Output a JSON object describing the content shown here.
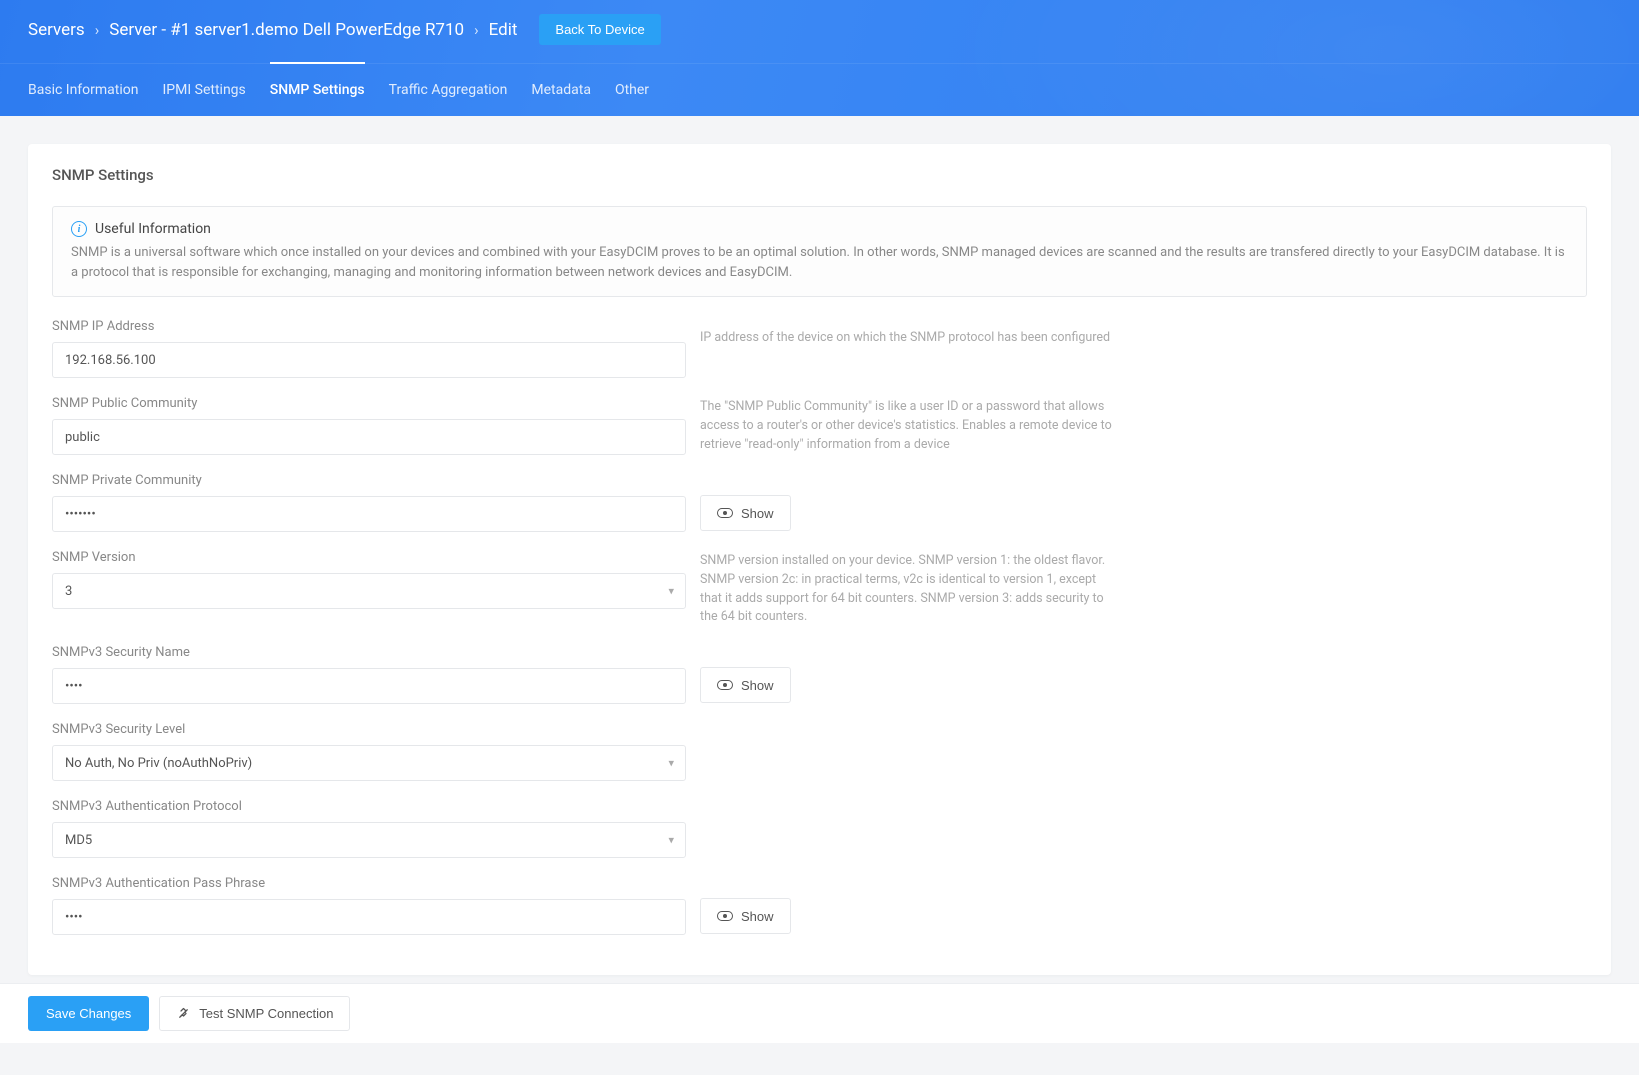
{
  "breadcrumb": {
    "root": "Servers",
    "server": "Server - #1 server1.demo Dell PowerEdge R710",
    "current": "Edit",
    "back_btn": "Back To Device"
  },
  "tabs": {
    "basic": "Basic Information",
    "ipmi": "IPMI Settings",
    "snmp": "SNMP Settings",
    "traffic": "Traffic Aggregation",
    "metadata": "Metadata",
    "other": "Other"
  },
  "section": {
    "title": "SNMP Settings"
  },
  "info": {
    "title": "Useful Information",
    "text": "SNMP is a universal software which once installed on your devices and combined with your EasyDCIM proves to be an optimal solution. In other words, SNMP managed devices are scanned and the results are transfered directly to your EasyDCIM database. It is a protocol that is responsible for exchanging, managing and monitoring information between network devices and EasyDCIM."
  },
  "fields": {
    "ip": {
      "label": "SNMP IP Address",
      "value": "192.168.56.100",
      "help": "IP address of the device on which the SNMP protocol has been configured"
    },
    "public_comm": {
      "label": "SNMP Public Community",
      "value": "public",
      "help": "The \"SNMP Public Community\" is like a user ID or a password that allows access to a router's or other device's statistics. Enables a remote device to retrieve \"read-only\" information from a device"
    },
    "private_comm": {
      "label": "SNMP Private Community",
      "value": "private",
      "show_label": "Show"
    },
    "version": {
      "label": "SNMP Version",
      "value": "3",
      "help": "SNMP version installed on your device. SNMP version 1: the oldest flavor. SNMP version 2c: in practical terms, v2c is identical to version 1, except that it adds support for 64 bit counters. SNMP version 3: adds security to the 64 bit counters."
    },
    "sec_name": {
      "label": "SNMPv3 Security Name",
      "value": "none",
      "show_label": "Show"
    },
    "sec_level": {
      "label": "SNMPv3 Security Level",
      "value": "No Auth, No Priv (noAuthNoPriv)"
    },
    "auth_proto": {
      "label": "SNMPv3 Authentication Protocol",
      "value": "MD5"
    },
    "auth_pass": {
      "label": "SNMPv3 Authentication Pass Phrase",
      "value": "none",
      "show_label": "Show"
    }
  },
  "footer": {
    "save": "Save Changes",
    "test": "Test SNMP Connection"
  }
}
